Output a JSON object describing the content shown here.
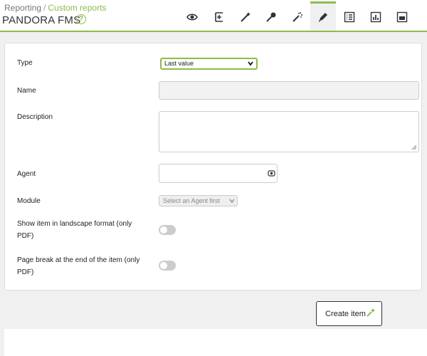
{
  "header": {
    "breadcrumb_root": "Reporting",
    "breadcrumb_sep": "/",
    "breadcrumb_current": "Custom reports",
    "title": "PANDORA FMS",
    "help_icon": "?"
  },
  "tabs": [
    {
      "icon": "eye-icon"
    },
    {
      "icon": "add-item-icon"
    },
    {
      "icon": "wand-icon"
    },
    {
      "icon": "pin-icon"
    },
    {
      "icon": "magic-wand-icon"
    },
    {
      "icon": "pencil-icon",
      "active": true
    },
    {
      "icon": "list-icon"
    },
    {
      "icon": "bar-chart-icon"
    },
    {
      "icon": "graph-icon"
    }
  ],
  "form": {
    "type_label": "Type",
    "type_value": "Last value",
    "name_label": "Name",
    "name_value": "",
    "description_label": "Description",
    "description_value": "",
    "agent_label": "Agent",
    "agent_value": "",
    "module_label": "Module",
    "module_placeholder": "Select an Agent first",
    "landscape_label_1": "Show item in landscape format (only",
    "landscape_label_2": "PDF)",
    "landscape_checked": false,
    "pagebreak_label_1": "Page break at the end of the item (only",
    "pagebreak_label_2": "PDF)",
    "pagebreak_checked": false
  },
  "actions": {
    "create_label": "Create item"
  },
  "colors": {
    "accent": "#8dbb4a"
  }
}
